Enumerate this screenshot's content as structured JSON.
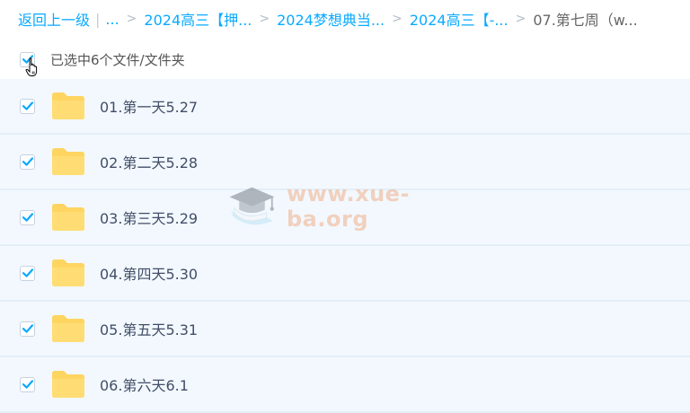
{
  "breadcrumb": {
    "back": "返回上一级",
    "separator": "|",
    "ellipsis": "...",
    "arrow": ">",
    "items": [
      "2024高三【押...",
      "2024梦想典当...",
      "2024高三【-..."
    ],
    "current": "07.第七周（w..."
  },
  "selection": {
    "text": "已选中6个文件/文件夹",
    "checked": true
  },
  "files": [
    {
      "name": "01.第一天5.27",
      "checked": true
    },
    {
      "name": "02.第二天5.28",
      "checked": true
    },
    {
      "name": "03.第三天5.29",
      "checked": true
    },
    {
      "name": "04.第四天5.30",
      "checked": true
    },
    {
      "name": "05.第五天5.31",
      "checked": true
    },
    {
      "name": "06.第六天6.1",
      "checked": true
    }
  ],
  "watermark": {
    "text": "www.xue-ba.org"
  },
  "icons": {
    "checkbox": "checkmark-icon",
    "folder": "folder-icon",
    "cursor": "hand-pointer-icon",
    "watermark_logo": "graduation-cap-icon"
  },
  "colors": {
    "link": "#09aaff",
    "check": "#09aaff",
    "folder": "#ffd561",
    "row_bg": "#f2f8fe",
    "watermark": "#f1b08a"
  }
}
